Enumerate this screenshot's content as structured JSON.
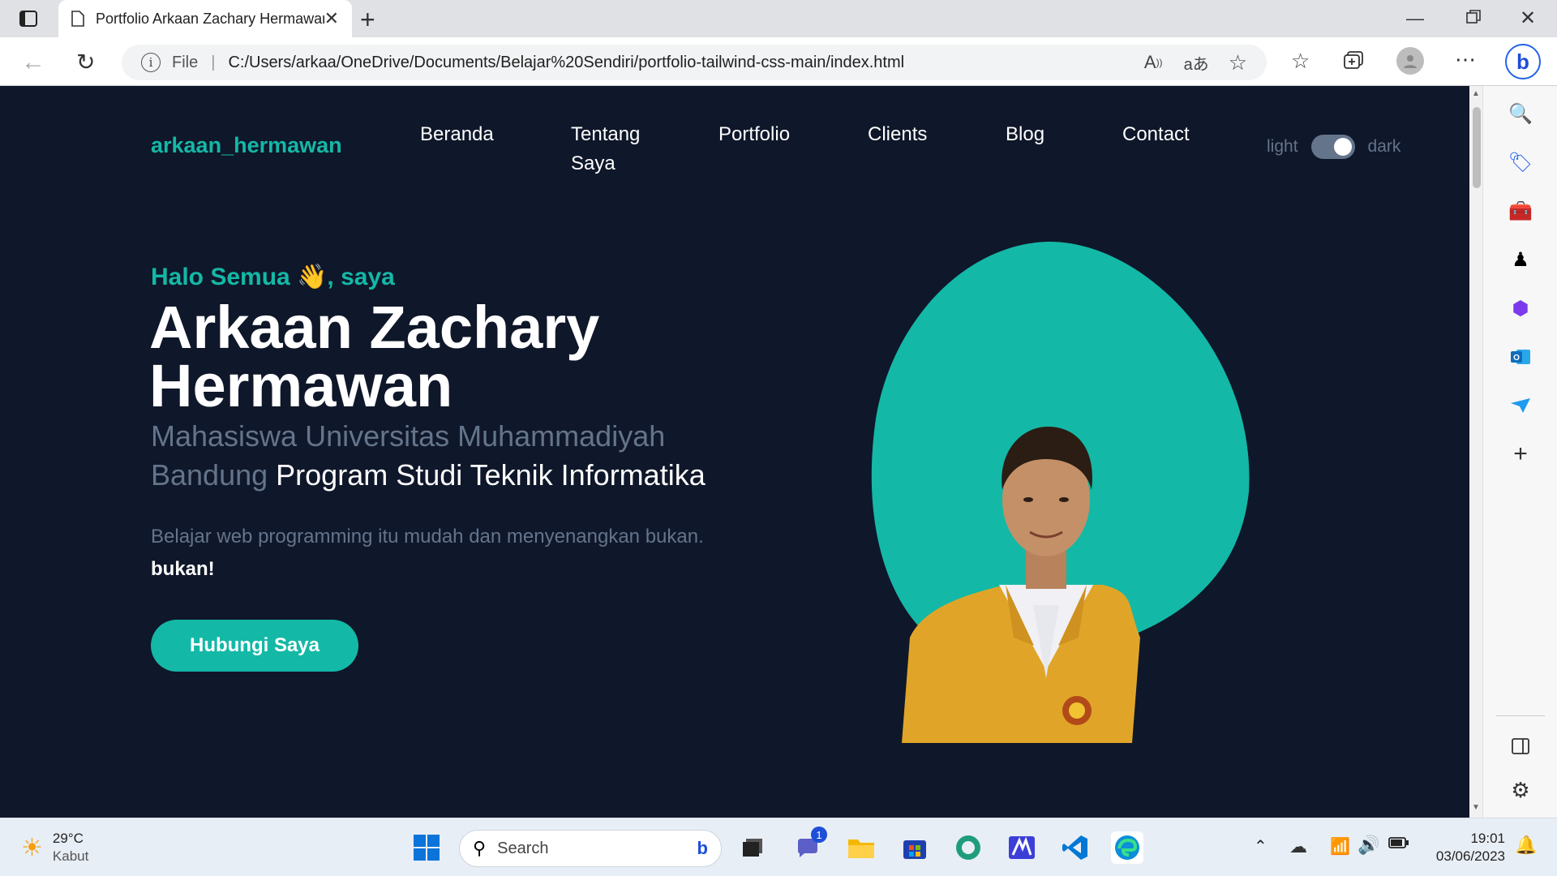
{
  "browser": {
    "tab_title": "Portfolio Arkaan Zachary Hermawan",
    "address_scheme": "File",
    "address_url": "C:/Users/arkaa/OneDrive/Documents/Belajar%20Sendiri/portfolio-tailwind-css-main/index.html",
    "icons": [
      "tab-actions-icon",
      "page-icon",
      "close-icon",
      "new-tab-icon",
      "minimize-icon",
      "restore-icon",
      "back-icon",
      "refresh-icon",
      "info-icon",
      "read-aloud-icon",
      "translate-icon",
      "add-favorite-icon",
      "favorites-icon",
      "collections-icon",
      "profile-icon",
      "more-icon",
      "bing-icon"
    ]
  },
  "site": {
    "logo": "arkaan_hermawan",
    "nav": [
      "Beranda",
      "Tentang Saya",
      "Portfolio",
      "Clients",
      "Blog",
      "Contact"
    ],
    "theme_light": "light",
    "theme_dark": "dark",
    "greeting": "Halo Semua 👋, saya",
    "name_line1": "Arkaan Zachary",
    "name_line2": "Hermawan",
    "subtitle_part1": "Mahasiswa Universitas Muhammadiyah Bandung",
    "subtitle_part2": "Program Studi Teknik Informatika",
    "tagline": "Belajar web programming itu mudah dan menyenangkan bukan.",
    "tagline_emphasis": "bukan!",
    "cta": "Hubungi Saya",
    "colors": {
      "bg": "#0f172a",
      "accent": "#14b8a6",
      "muted": "#64748b"
    }
  },
  "taskbar": {
    "weather_temp": "29°C",
    "weather_desc": "Kabut",
    "search_placeholder": "Search",
    "chat_badge": "1",
    "time": "19:01",
    "date": "03/06/2023"
  }
}
